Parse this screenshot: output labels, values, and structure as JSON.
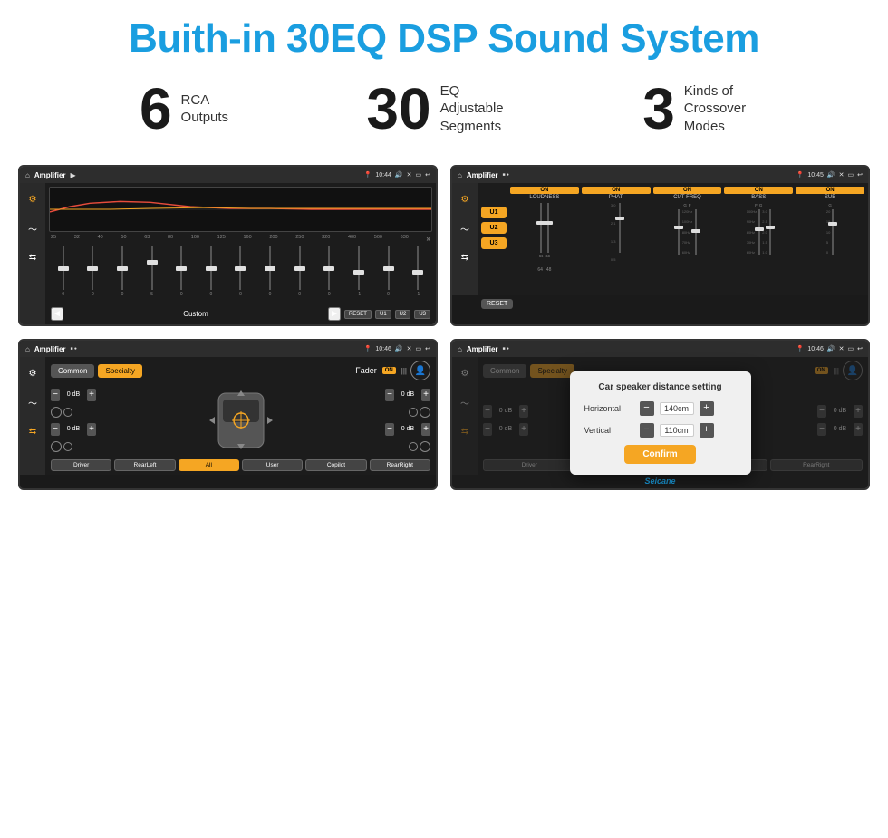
{
  "header": {
    "title": "Buith-in 30EQ DSP Sound System"
  },
  "stats": [
    {
      "number": "6",
      "label": "RCA\nOutputs"
    },
    {
      "number": "30",
      "label": "EQ Adjustable\nSegments"
    },
    {
      "number": "3",
      "label": "Kinds of\nCrossover Modes"
    }
  ],
  "screens": {
    "screen1": {
      "title": "Amplifier",
      "time": "10:44",
      "freq_labels": [
        "25",
        "32",
        "40",
        "50",
        "63",
        "80",
        "100",
        "125",
        "160",
        "200",
        "250",
        "320",
        "400",
        "500",
        "630"
      ],
      "fader_values": [
        "0",
        "0",
        "0",
        "5",
        "0",
        "0",
        "0",
        "0",
        "0",
        "0",
        "-1",
        "0",
        "-1"
      ],
      "preset": "Custom",
      "buttons": [
        "RESET",
        "U1",
        "U2",
        "U3"
      ]
    },
    "screen2": {
      "title": "Amplifier",
      "time": "10:45",
      "channels": [
        "LOUDNESS",
        "PHAT",
        "CUT FREQ",
        "BASS",
        "SUB"
      ],
      "u_buttons": [
        "U1",
        "U2",
        "U3"
      ],
      "reset_label": "RESET"
    },
    "screen3": {
      "title": "Amplifier",
      "time": "10:46",
      "tabs": [
        "Common",
        "Specialty"
      ],
      "fader_label": "Fader",
      "on_badge": "ON",
      "vol_rows": [
        {
          "label": "",
          "value": "0 dB"
        },
        {
          "label": "",
          "value": "0 dB"
        },
        {
          "label": "",
          "value": "0 dB"
        },
        {
          "label": "",
          "value": "0 dB"
        }
      ],
      "bottom_buttons": [
        "Driver",
        "RearLeft",
        "All",
        "User",
        "Copilot",
        "RearRight"
      ]
    },
    "screen4": {
      "title": "Amplifier",
      "time": "10:46",
      "tabs": [
        "Common",
        "Specialty"
      ],
      "on_badge": "ON",
      "dialog": {
        "title": "Car speaker distance setting",
        "horizontal_label": "Horizontal",
        "horizontal_value": "140cm",
        "vertical_label": "Vertical",
        "vertical_value": "110cm",
        "confirm_label": "Confirm"
      },
      "bottom_buttons": [
        "Driver",
        "RearLeft",
        "Copilot",
        "RearRight"
      ]
    }
  },
  "watermark": "Seicane"
}
